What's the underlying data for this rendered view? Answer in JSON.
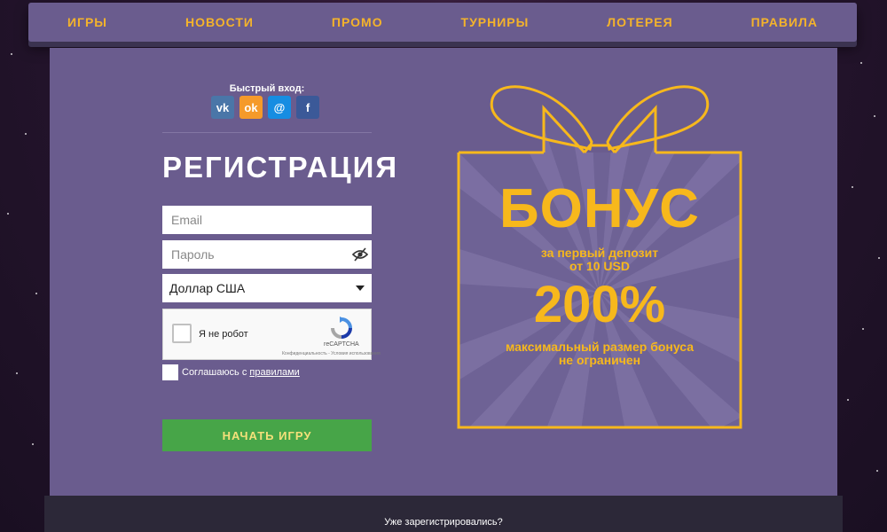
{
  "nav": {
    "items": [
      {
        "label": "ИГРЫ"
      },
      {
        "label": "НОВОСТИ"
      },
      {
        "label": "ПРОМО"
      },
      {
        "label": "ТУРНИРЫ"
      },
      {
        "label": "ЛОТЕРЕЯ"
      },
      {
        "label": "ПРАВИЛА"
      }
    ]
  },
  "quick_login": {
    "label": "Быстрый вход:",
    "providers": [
      {
        "name": "vk",
        "icon": "vk-icon",
        "glyph": "vk",
        "color": "#4a76a8"
      },
      {
        "name": "odnoklassniki",
        "icon": "odnoklassniki-icon",
        "glyph": "ok",
        "color": "#f59a2a"
      },
      {
        "name": "mailru",
        "icon": "mailru-icon",
        "glyph": "@",
        "color": "#168de2"
      },
      {
        "name": "facebook",
        "icon": "facebook-icon",
        "glyph": "f",
        "color": "#3b5998"
      }
    ]
  },
  "form": {
    "title": "РЕГИСТРАЦИЯ",
    "email_placeholder": "Email",
    "password_placeholder": "Пароль",
    "currency": "Доллар США",
    "captcha": {
      "label": "Я не робот",
      "brand": "reCAPTCHA",
      "terms": "Конфиденциальность - Условия использования"
    },
    "agree_prefix": "Соглашаюсь с ",
    "agree_link": "правилами",
    "submit": "НАЧАТЬ ИГРУ"
  },
  "bonus": {
    "title": "БОНУС",
    "line1": "за первый депозит",
    "line2": "от 10 USD",
    "percent": "200%",
    "max_line1": "максимальный размер бонуса",
    "max_line2": "не ограничен"
  },
  "footer": {
    "already": "Уже зарегистрировались?"
  },
  "colors": {
    "accent": "#f7b81c",
    "panel": "#6a5c8e",
    "button": "#47a548"
  }
}
